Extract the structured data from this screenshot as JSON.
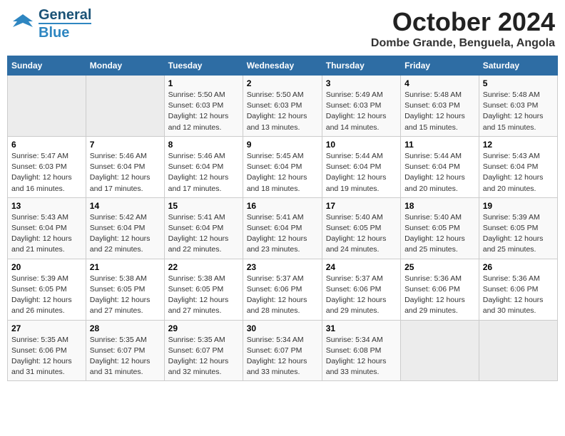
{
  "header": {
    "logo_general": "General",
    "logo_blue": "Blue",
    "title": "October 2024",
    "subtitle": "Dombe Grande, Benguela, Angola"
  },
  "columns": [
    "Sunday",
    "Monday",
    "Tuesday",
    "Wednesday",
    "Thursday",
    "Friday",
    "Saturday"
  ],
  "weeks": [
    [
      {
        "num": "",
        "info": ""
      },
      {
        "num": "",
        "info": ""
      },
      {
        "num": "1",
        "info": "Sunrise: 5:50 AM\nSunset: 6:03 PM\nDaylight: 12 hours\nand 12 minutes."
      },
      {
        "num": "2",
        "info": "Sunrise: 5:50 AM\nSunset: 6:03 PM\nDaylight: 12 hours\nand 13 minutes."
      },
      {
        "num": "3",
        "info": "Sunrise: 5:49 AM\nSunset: 6:03 PM\nDaylight: 12 hours\nand 14 minutes."
      },
      {
        "num": "4",
        "info": "Sunrise: 5:48 AM\nSunset: 6:03 PM\nDaylight: 12 hours\nand 15 minutes."
      },
      {
        "num": "5",
        "info": "Sunrise: 5:48 AM\nSunset: 6:03 PM\nDaylight: 12 hours\nand 15 minutes."
      }
    ],
    [
      {
        "num": "6",
        "info": "Sunrise: 5:47 AM\nSunset: 6:03 PM\nDaylight: 12 hours\nand 16 minutes."
      },
      {
        "num": "7",
        "info": "Sunrise: 5:46 AM\nSunset: 6:04 PM\nDaylight: 12 hours\nand 17 minutes."
      },
      {
        "num": "8",
        "info": "Sunrise: 5:46 AM\nSunset: 6:04 PM\nDaylight: 12 hours\nand 17 minutes."
      },
      {
        "num": "9",
        "info": "Sunrise: 5:45 AM\nSunset: 6:04 PM\nDaylight: 12 hours\nand 18 minutes."
      },
      {
        "num": "10",
        "info": "Sunrise: 5:44 AM\nSunset: 6:04 PM\nDaylight: 12 hours\nand 19 minutes."
      },
      {
        "num": "11",
        "info": "Sunrise: 5:44 AM\nSunset: 6:04 PM\nDaylight: 12 hours\nand 20 minutes."
      },
      {
        "num": "12",
        "info": "Sunrise: 5:43 AM\nSunset: 6:04 PM\nDaylight: 12 hours\nand 20 minutes."
      }
    ],
    [
      {
        "num": "13",
        "info": "Sunrise: 5:43 AM\nSunset: 6:04 PM\nDaylight: 12 hours\nand 21 minutes."
      },
      {
        "num": "14",
        "info": "Sunrise: 5:42 AM\nSunset: 6:04 PM\nDaylight: 12 hours\nand 22 minutes."
      },
      {
        "num": "15",
        "info": "Sunrise: 5:41 AM\nSunset: 6:04 PM\nDaylight: 12 hours\nand 22 minutes."
      },
      {
        "num": "16",
        "info": "Sunrise: 5:41 AM\nSunset: 6:04 PM\nDaylight: 12 hours\nand 23 minutes."
      },
      {
        "num": "17",
        "info": "Sunrise: 5:40 AM\nSunset: 6:05 PM\nDaylight: 12 hours\nand 24 minutes."
      },
      {
        "num": "18",
        "info": "Sunrise: 5:40 AM\nSunset: 6:05 PM\nDaylight: 12 hours\nand 25 minutes."
      },
      {
        "num": "19",
        "info": "Sunrise: 5:39 AM\nSunset: 6:05 PM\nDaylight: 12 hours\nand 25 minutes."
      }
    ],
    [
      {
        "num": "20",
        "info": "Sunrise: 5:39 AM\nSunset: 6:05 PM\nDaylight: 12 hours\nand 26 minutes."
      },
      {
        "num": "21",
        "info": "Sunrise: 5:38 AM\nSunset: 6:05 PM\nDaylight: 12 hours\nand 27 minutes."
      },
      {
        "num": "22",
        "info": "Sunrise: 5:38 AM\nSunset: 6:05 PM\nDaylight: 12 hours\nand 27 minutes."
      },
      {
        "num": "23",
        "info": "Sunrise: 5:37 AM\nSunset: 6:06 PM\nDaylight: 12 hours\nand 28 minutes."
      },
      {
        "num": "24",
        "info": "Sunrise: 5:37 AM\nSunset: 6:06 PM\nDaylight: 12 hours\nand 29 minutes."
      },
      {
        "num": "25",
        "info": "Sunrise: 5:36 AM\nSunset: 6:06 PM\nDaylight: 12 hours\nand 29 minutes."
      },
      {
        "num": "26",
        "info": "Sunrise: 5:36 AM\nSunset: 6:06 PM\nDaylight: 12 hours\nand 30 minutes."
      }
    ],
    [
      {
        "num": "27",
        "info": "Sunrise: 5:35 AM\nSunset: 6:06 PM\nDaylight: 12 hours\nand 31 minutes."
      },
      {
        "num": "28",
        "info": "Sunrise: 5:35 AM\nSunset: 6:07 PM\nDaylight: 12 hours\nand 31 minutes."
      },
      {
        "num": "29",
        "info": "Sunrise: 5:35 AM\nSunset: 6:07 PM\nDaylight: 12 hours\nand 32 minutes."
      },
      {
        "num": "30",
        "info": "Sunrise: 5:34 AM\nSunset: 6:07 PM\nDaylight: 12 hours\nand 33 minutes."
      },
      {
        "num": "31",
        "info": "Sunrise: 5:34 AM\nSunset: 6:08 PM\nDaylight: 12 hours\nand 33 minutes."
      },
      {
        "num": "",
        "info": ""
      },
      {
        "num": "",
        "info": ""
      }
    ]
  ]
}
